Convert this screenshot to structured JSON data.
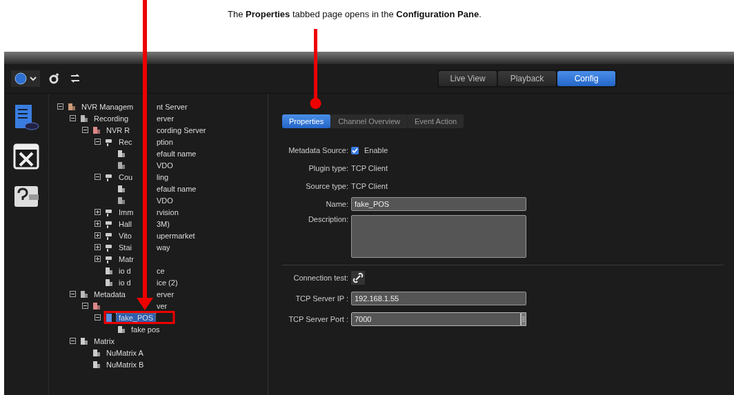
{
  "caption": "The **Properties** tabbed page opens in the **Configuration Pane**.",
  "mode_tabs": [
    {
      "label": "Live View",
      "selected": false
    },
    {
      "label": "Playback",
      "selected": false
    },
    {
      "label": "Config",
      "selected": true
    }
  ],
  "tree": [
    {
      "label": "NVR Managem",
      "label_right": "nt Server",
      "kind": "site",
      "expanded": true,
      "selected": false,
      "children": [
        {
          "label": "Recording",
          "label_right": "erver",
          "kind": "group",
          "expanded": true,
          "selected": false,
          "children": [
            {
              "label": "NVR R",
              "label_right": "cording Server",
              "kind": "server",
              "expanded": true,
              "selected": false,
              "children": [
                {
                  "label": "Rec",
                  "label_right": "ption",
                  "kind": "camera",
                  "expanded": true,
                  "selected": false,
                  "children": [
                    {
                      "label_right": "efault name",
                      "kind": "stream",
                      "selected": false
                    },
                    {
                      "label_right": "VDO",
                      "kind": "record",
                      "selected": false
                    }
                  ]
                },
                {
                  "label": "Cou",
                  "label_right": "ling",
                  "kind": "camera",
                  "expanded": true,
                  "selected": false,
                  "children": [
                    {
                      "label_right": "efault name",
                      "kind": "stream",
                      "selected": false
                    },
                    {
                      "label_right": "VDO",
                      "kind": "record",
                      "selected": false
                    }
                  ]
                },
                {
                  "label": "Imm",
                  "label_right": "rvision",
                  "kind": "camera",
                  "expanded": false,
                  "selected": false
                },
                {
                  "label": "Hall",
                  "label_right": "3M)",
                  "kind": "camera",
                  "expanded": false,
                  "selected": false
                },
                {
                  "label": "Vito",
                  "label_right": "upermarket",
                  "kind": "camera",
                  "expanded": false,
                  "selected": false
                },
                {
                  "label": "Stai",
                  "label_right": "way",
                  "kind": "camera",
                  "expanded": false,
                  "selected": false
                },
                {
                  "label": "Matr",
                  "kind": "camera",
                  "expanded": false,
                  "selected": false
                },
                {
                  "label": "io d",
                  "label_right": "ce",
                  "kind": "io",
                  "selected": false
                },
                {
                  "label": "io d",
                  "label_right": "ice (2)",
                  "kind": "io",
                  "selected": false
                }
              ]
            }
          ]
        },
        {
          "label": "Metadata",
          "label_right": "erver",
          "kind": "group",
          "expanded": true,
          "selected": false,
          "children": [
            {
              "label_right": "ver",
              "kind": "server",
              "expanded": true,
              "selected": false,
              "children": [
                {
                  "label": "fake_POS",
                  "kind": "source",
                  "expanded": true,
                  "selected": true,
                  "children": [
                    {
                      "label": "fake pos",
                      "kind": "io",
                      "selected": false
                    }
                  ]
                }
              ]
            }
          ]
        },
        {
          "label": "Matrix",
          "kind": "matrix",
          "expanded": true,
          "selected": false,
          "children": [
            {
              "label": "NuMatrix A",
              "kind": "matrix",
              "selected": false
            },
            {
              "label": "NuMatrix B",
              "kind": "matrix",
              "selected": false
            }
          ]
        }
      ]
    }
  ],
  "config_tabs": [
    {
      "label": "Properties",
      "selected": true
    },
    {
      "label": "Channel Overview",
      "selected": false
    },
    {
      "label": "Event Action",
      "selected": false
    }
  ],
  "form": {
    "metadata_source": {
      "label": "Metadata Source:",
      "checkbox_label": "Enable",
      "checked": true
    },
    "plugin_type": {
      "label": "Plugin type:",
      "value": "TCP Client"
    },
    "source_type": {
      "label": "Source type:",
      "value": "TCP Client"
    },
    "name": {
      "label": "Name:",
      "value": "fake_POS"
    },
    "description": {
      "label": "Description:"
    },
    "connection_test": {
      "label": "Connection test:"
    },
    "server_ip": {
      "label": "TCP Server IP :",
      "value": "192.168.1.55"
    },
    "server_port": {
      "label": "TCP Server Port :",
      "value": "7000"
    }
  }
}
